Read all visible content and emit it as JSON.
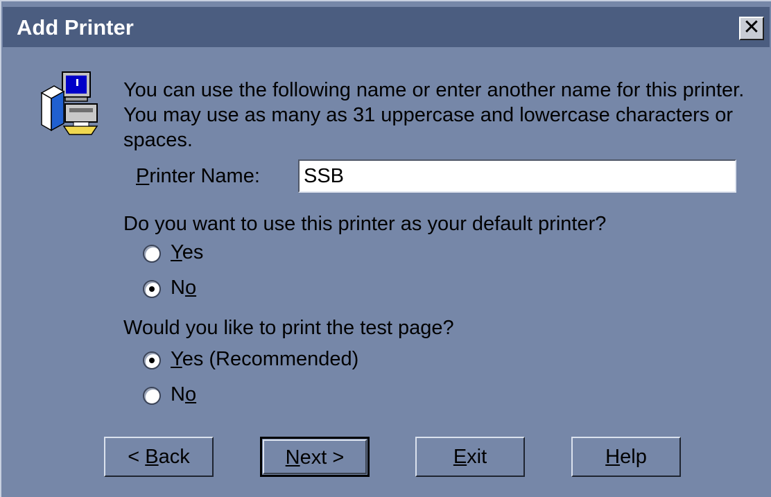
{
  "window": {
    "title": "Add Printer",
    "close_label": "✕"
  },
  "intro": {
    "line1": "You can use the following name or enter another name for this printer.",
    "line2": "You may use as many as 31 uppercase and lowercase characters or",
    "line3": "spaces."
  },
  "printer_name": {
    "label_accel": "P",
    "label_rest": "rinter Name:",
    "value": "SSB"
  },
  "default_printer": {
    "question": "Do you want to use this printer as your default printer?",
    "options": [
      {
        "accel": "Y",
        "rest": "es",
        "selected": false
      },
      {
        "pre": "N",
        "accel": "o",
        "selected": true
      }
    ]
  },
  "test_page": {
    "question": "Would you like to print the test page?",
    "options": [
      {
        "accel": "Y",
        "rest": "es (Recommended)",
        "selected": true
      },
      {
        "pre": "N",
        "accel": "o",
        "selected": false
      }
    ]
  },
  "buttons": {
    "back": {
      "pre": "< ",
      "accel": "B",
      "rest": "ack"
    },
    "next": {
      "accel": "N",
      "rest": "ext >"
    },
    "exit": {
      "accel": "E",
      "rest": "xit"
    },
    "help": {
      "accel": "H",
      "rest": "elp"
    }
  },
  "icon": "printer-setup-icon",
  "colors": {
    "background": "#7687a8",
    "titlebar": "#4b5d80"
  }
}
